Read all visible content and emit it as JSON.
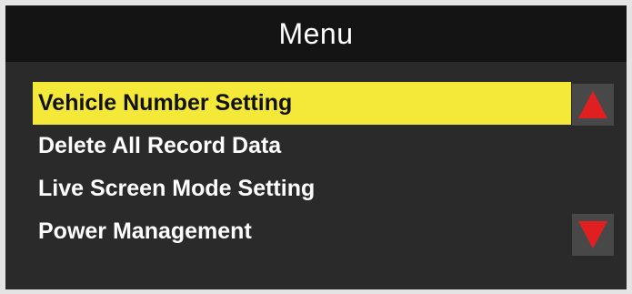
{
  "window": {
    "title": "Menu"
  },
  "menu": {
    "items": [
      {
        "label": "Vehicle Number Setting",
        "selected": true
      },
      {
        "label": "Delete All Record Data",
        "selected": false
      },
      {
        "label": "Live Screen Mode Setting",
        "selected": false
      },
      {
        "label": "Power Management",
        "selected": false
      }
    ]
  },
  "scroll": {
    "up_icon": "triangle-up-icon",
    "down_icon": "triangle-down-icon"
  },
  "colors": {
    "highlight": "#f4e838",
    "arrow": "#e02020",
    "background": "#2a2a2a",
    "header": "#141414"
  }
}
